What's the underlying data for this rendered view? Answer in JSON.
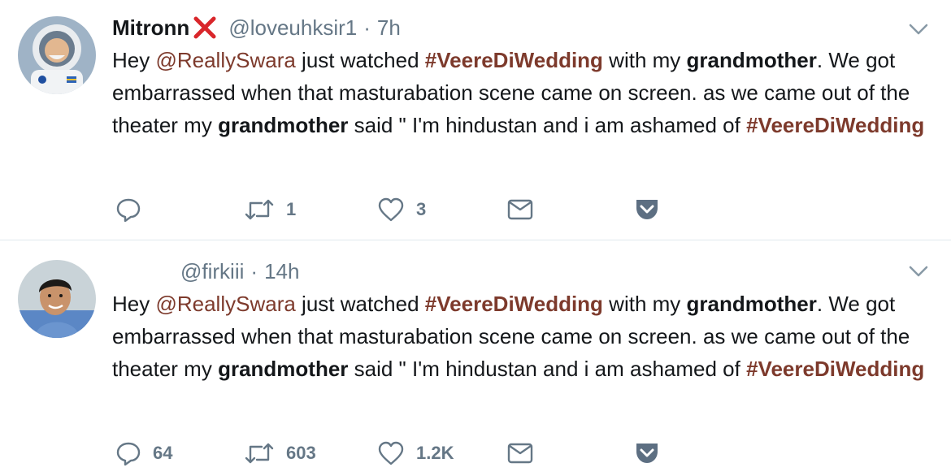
{
  "tweets": [
    {
      "display_name": "Mitronn",
      "handle": "@loveuhksir1",
      "separator": "·",
      "time": "7h",
      "text": {
        "t1": "Hey ",
        "mention": "@ReallySwara",
        "t2": " just watched ",
        "hashtag1": "#VeereDiWedding",
        "t3": " with my ",
        "bold1": "grandmother",
        "t4": ". We got embarrassed when that masturabation scene came on screen. as we came out of the theater my ",
        "bold2": "grandmother",
        "t5": " said \" I'm hindustan and i am ashamed of ",
        "hashtag2": "#VeereDiWedding"
      },
      "stats": {
        "replies": "",
        "retweets": "1",
        "likes": "3"
      }
    },
    {
      "display_name": "",
      "handle": "@firkiii",
      "separator": "·",
      "time": "14h",
      "text": {
        "t1": "Hey ",
        "mention": "@ReallySwara",
        "t2": " just watched ",
        "hashtag1": "#VeereDiWedding",
        "t3": " with my ",
        "bold1": "grandmother",
        "t4": ". We got embarrassed when that masturabation scene came on screen. as we came out of the theater my ",
        "bold2": "grandmother",
        "t5": " said \" I'm hindustan and i am ashamed of ",
        "hashtag2": "#VeereDiWedding"
      },
      "stats": {
        "replies": "64",
        "retweets": "603",
        "likes": "1.2K"
      }
    }
  ],
  "icons": {
    "reply": "reply-icon",
    "retweet": "retweet-icon",
    "like": "heart-icon",
    "dm": "envelope-icon",
    "pocket": "pocket-icon",
    "caret": "chevron-down-icon",
    "name_badge": "red-cross-icon"
  },
  "colors": {
    "link": "#7d3a2c",
    "secondary_text": "#657786",
    "text": "#14171a",
    "divider": "#e1e8ed",
    "badge_red": "#d9262b",
    "pocket": "#5d6f82"
  }
}
